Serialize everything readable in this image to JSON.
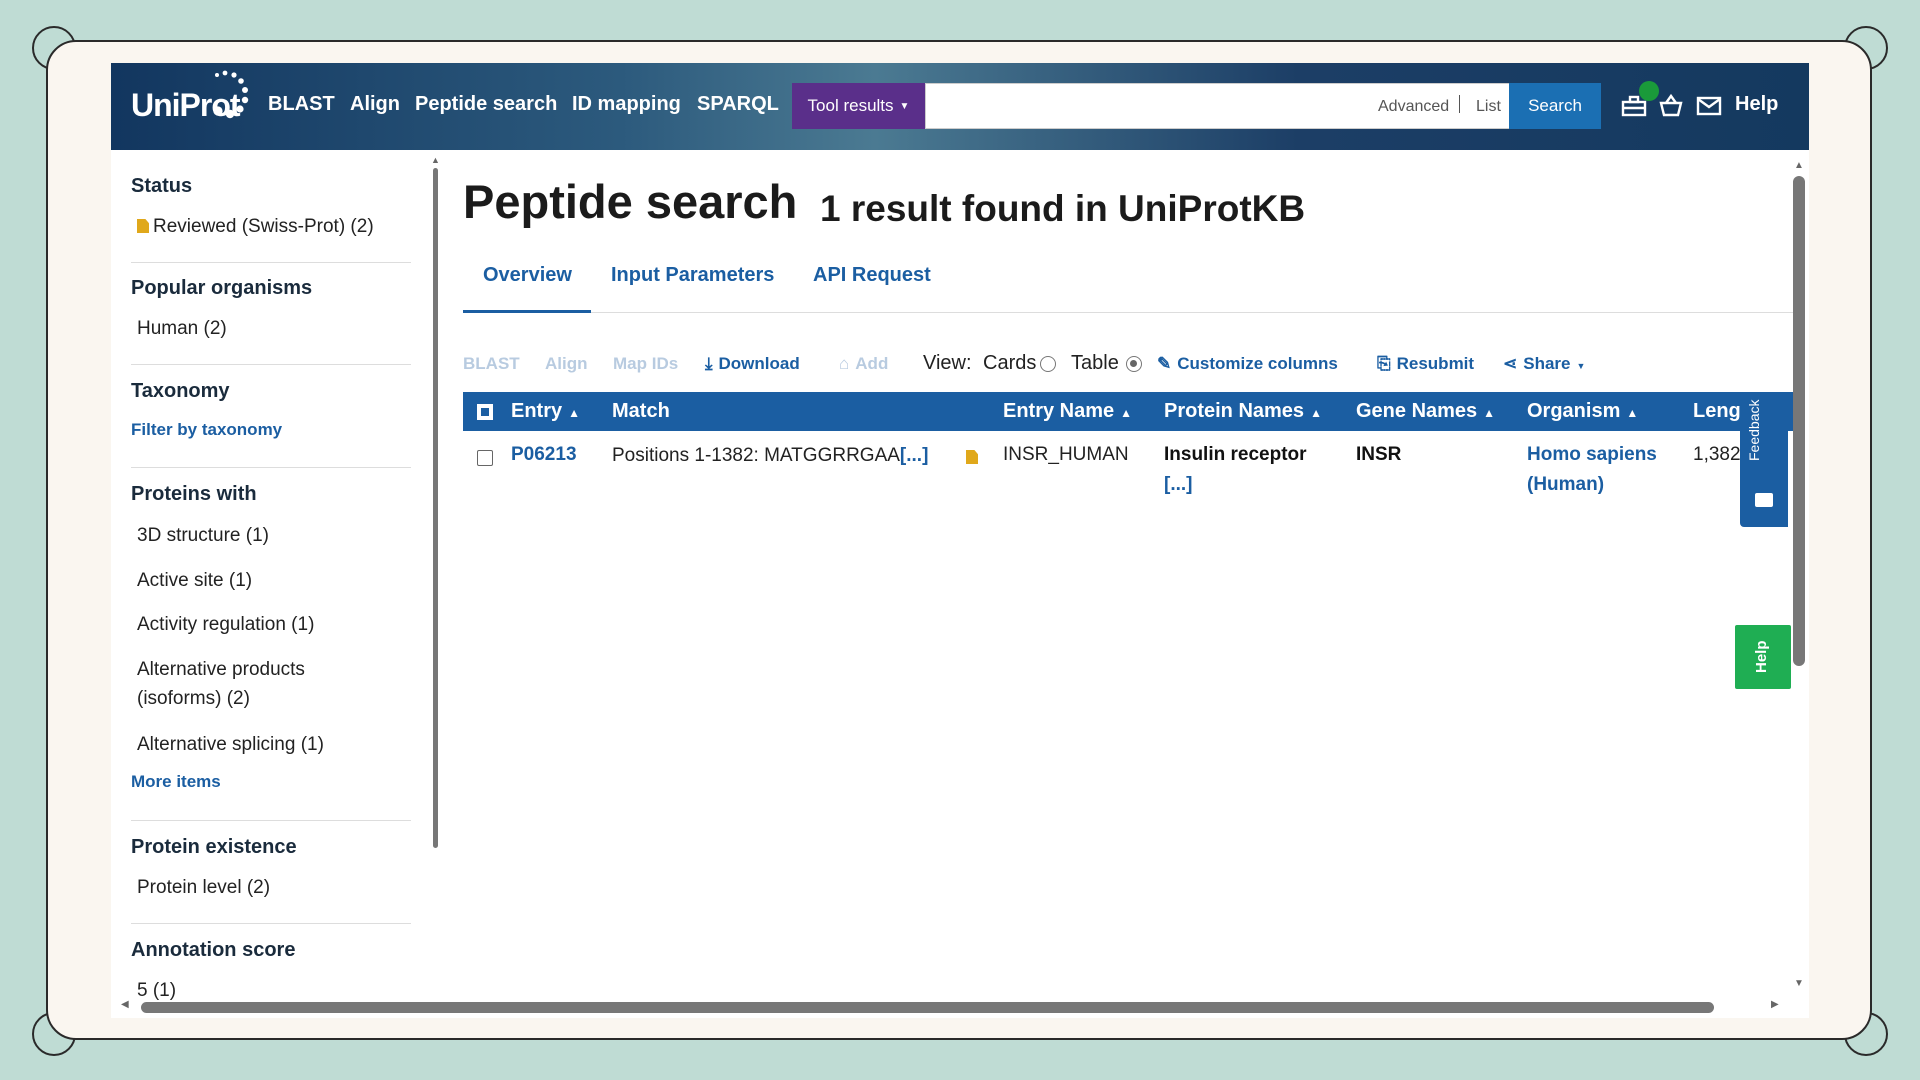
{
  "header": {
    "logo": "UniProt",
    "nav": [
      "BLAST",
      "Align",
      "Peptide search",
      "ID mapping",
      "SPARQL"
    ],
    "tool_results": "Tool results",
    "search_value": "",
    "advanced": "Advanced",
    "list": "List",
    "search_button": "Search",
    "help": "Help"
  },
  "sidebar": {
    "status_title": "Status",
    "status_item": "Reviewed (Swiss-Prot) (2)",
    "popular_title": "Popular organisms",
    "popular_item": "Human (2)",
    "taxonomy_title": "Taxonomy",
    "taxonomy_link": "Filter by taxonomy",
    "proteins_title": "Proteins with",
    "proteins_items": [
      "3D structure (1)",
      "Active site (1)",
      "Activity regulation (1)",
      "Alternative products",
      "(isoforms) (2)",
      "Alternative splicing (1)"
    ],
    "more_items": "More items",
    "existence_title": "Protein existence",
    "existence_item": "Protein level (2)",
    "annotation_title": "Annotation score",
    "annotation_item": "5 (1)"
  },
  "main": {
    "title": "Peptide search",
    "subtitle": "1 result found in UniProtKB",
    "tabs": [
      "Overview",
      "Input Parameters",
      "API Request"
    ],
    "toolbar": {
      "blast": "BLAST",
      "align": "Align",
      "map_ids": "Map IDs",
      "download": "Download",
      "add": "Add",
      "view": "View:",
      "cards": "Cards",
      "table": "Table",
      "customize": "Customize columns",
      "resubmit": "Resubmit",
      "share": "Share"
    },
    "columns": [
      "Entry",
      "Match",
      "Entry Name",
      "Protein Names",
      "Gene Names",
      "Organism",
      "Leng"
    ],
    "row": {
      "entry": "P06213",
      "match": "Positions 1-1382: MATGGRRGAA",
      "match_more": "[...]",
      "entry_name": "INSR_HUMAN",
      "protein_name": "Insulin receptor",
      "protein_more": "[...]",
      "gene": "INSR",
      "organism_1": "Homo sapiens",
      "organism_2": "(Human)",
      "length": "1,382"
    },
    "feedback": "Feedback",
    "help_tab": "Help"
  },
  "colors": {
    "header_blue": "#12365f",
    "tool_results_purple": "#5a2f8a",
    "link_blue": "#1b5ea2",
    "help_green": "#1fae53"
  }
}
